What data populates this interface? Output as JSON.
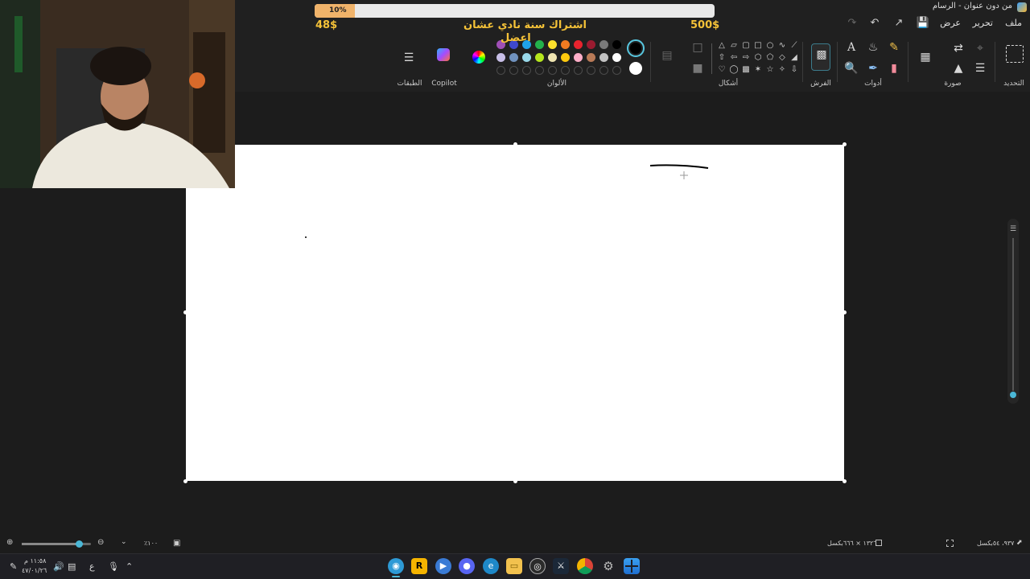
{
  "window": {
    "title": "من دون عنوان - الرسام"
  },
  "menu": {
    "file": "ملف",
    "edit": "تحرير",
    "view": "عرض"
  },
  "ribbon": {
    "groups": {
      "selection": "التحديد",
      "image": "صورة",
      "tools": "أدوات",
      "brushes": "الفرش",
      "shapes": "أشكال",
      "colors": "الألوان",
      "copilot": "Copilot",
      "layers": "الطبقات"
    },
    "palette_row1": [
      "#000000",
      "#7a7a7a",
      "#9b1b30",
      "#e8232e",
      "#f27b21",
      "#fde12c",
      "#23b14c",
      "#1fa3e8",
      "#3f48cc",
      "#9f4fb6"
    ],
    "palette_row2": [
      "#ffffff",
      "#c3c3c3",
      "#b97a57",
      "#ffaec9",
      "#ffc90e",
      "#efe4b0",
      "#b5e61d",
      "#99d9ea",
      "#7092be",
      "#c8bfe7"
    ],
    "primary_color": "#000000",
    "secondary_color": "#ffffff"
  },
  "overlay": {
    "progress_percent": 10,
    "progress_label": "10%",
    "headline_line1": "اشتراك سنة نادي عشان",
    "headline_line2": "اعضل",
    "left_amount": "48$",
    "right_amount": "500$"
  },
  "status": {
    "cursor_position": "٩٣٧، ٥٤بكسل",
    "canvas_size": "١٣٢٦ × ٦٦٦بكسل",
    "zoom": "٪١٠٠"
  },
  "taskbar": {
    "time": "١١:٥٨ م",
    "date": "٤٧/٠١/٢٦",
    "lang": "ع"
  }
}
